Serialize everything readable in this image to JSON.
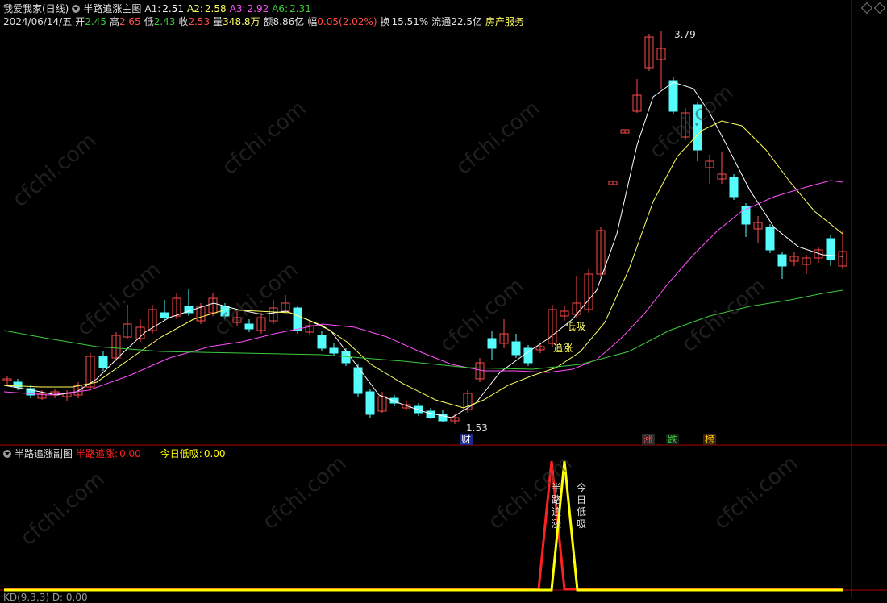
{
  "header": {
    "title": "我爱我家(日线)",
    "indicator": "半路追涨主图",
    "a1_label": "A1:",
    "a1": "2.51",
    "a2_label": "A2:",
    "a2": "2.58",
    "a3_label": "A3:",
    "a3": "2.92",
    "a6_label": "A6:",
    "a6": "2.31"
  },
  "quote": {
    "date": "2024/06/14/五",
    "open_label": "开",
    "open": "2.45",
    "high_label": "高",
    "high": "2.65",
    "low_label": "低",
    "low": "2.43",
    "close_label": "收",
    "close": "2.53",
    "vol_label": "量",
    "vol": "348.8万",
    "amt_label": "额",
    "amt": "8.86亿",
    "chg_label": "幅",
    "chg": "0.05(2.02%)",
    "turnover_label": "换",
    "turnover": "15.51%",
    "float_label": "流通",
    "float": "22.5亿",
    "industry": "房产服务"
  },
  "annotations": {
    "high_price": "3.79",
    "low_price": "1.53",
    "dixi": "低吸",
    "zhuizhang": "追涨",
    "badge_cai": "财",
    "badge_zhang": "涨",
    "badge_die": "跌",
    "badge_bang": "榜"
  },
  "sub_panel": {
    "title": "半路追涨副图",
    "s1_label": "半路追涨:",
    "s1": "0.00",
    "s2_label": "今日低吸:",
    "s2": "0.00",
    "v1": "半路追涨",
    "v2": "今日低吸",
    "bottom": "KD(9,3,3)  D:  0.00"
  },
  "watermark": "cfchi.com",
  "colors": {
    "up": "#ff4a4a",
    "down": "#54fcfc",
    "ma1": "#ffffff",
    "ma2": "#ffff60",
    "ma3": "#ff50ff",
    "ma4": "#3ccc3c",
    "sig1": "#ff2020",
    "sig2": "#ffff00",
    "divider": "#b00000"
  }
}
